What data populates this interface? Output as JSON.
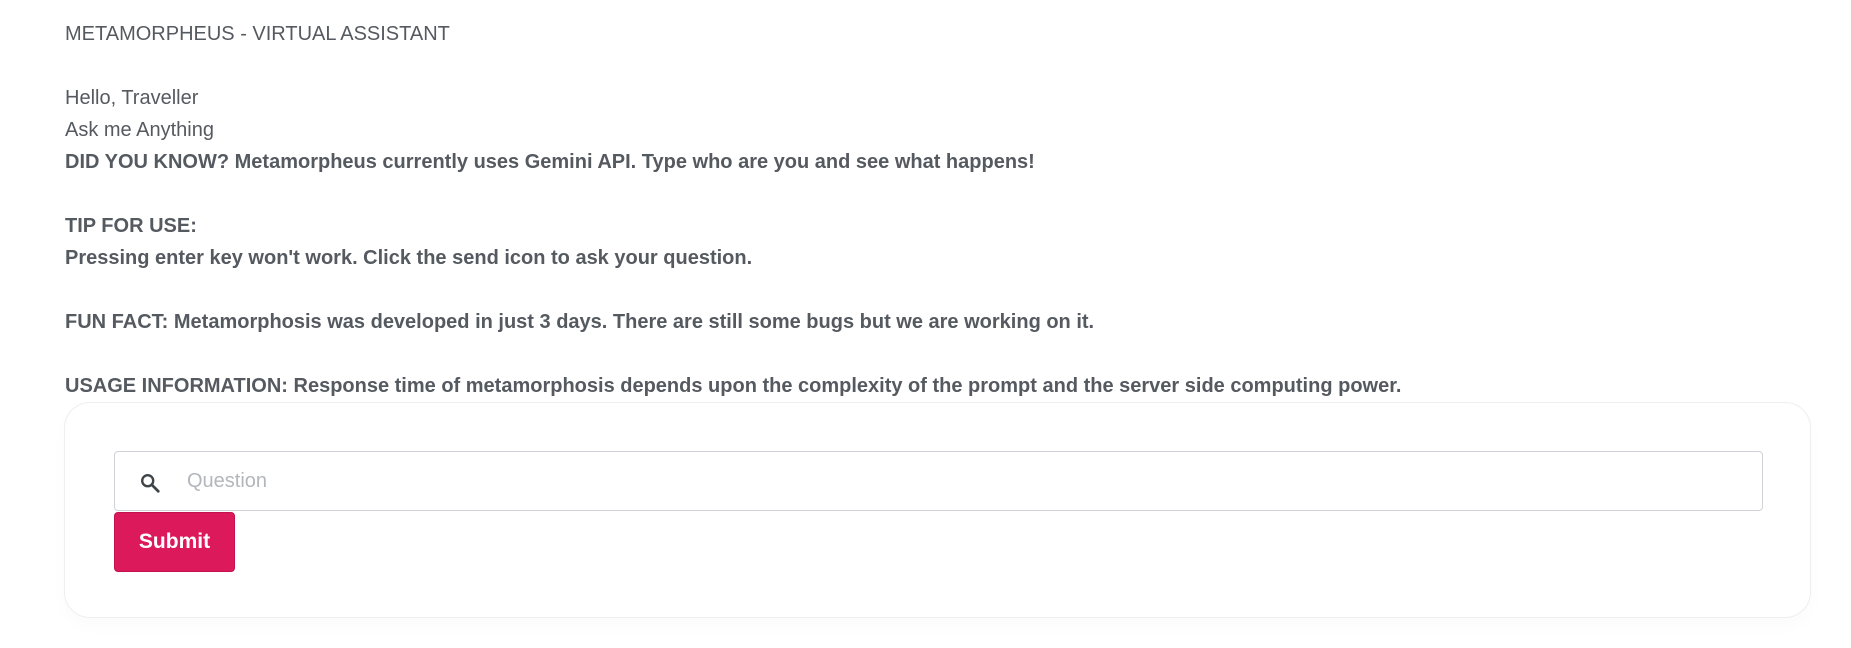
{
  "header": {
    "title": "METAMORPHEUS - VIRTUAL ASSISTANT"
  },
  "intro": {
    "greeting": "Hello, Traveller",
    "prompt": "Ask me Anything",
    "did_you_know": "DID YOU KNOW? Metamorpheus currently uses Gemini API. Type who are you and see what happens!"
  },
  "tip": {
    "heading": "TIP FOR USE:",
    "text": "Pressing enter key won't work. Click the send icon to ask your question."
  },
  "fun_fact": "FUN FACT: Metamorphosis was developed in just 3 days. There are still some bugs but we are working on it.",
  "usage_info": "USAGE INFORMATION: Response time of metamorphosis depends upon the complexity of the prompt and the server side computing power.",
  "form": {
    "search_icon": "search-icon",
    "question_placeholder": "Question",
    "question_value": "",
    "submit_label": "Submit"
  },
  "colors": {
    "text": "#555a60",
    "submit_background": "#dc1a5b",
    "submit_text": "#ffffff",
    "placeholder": "#b3b7bc"
  }
}
